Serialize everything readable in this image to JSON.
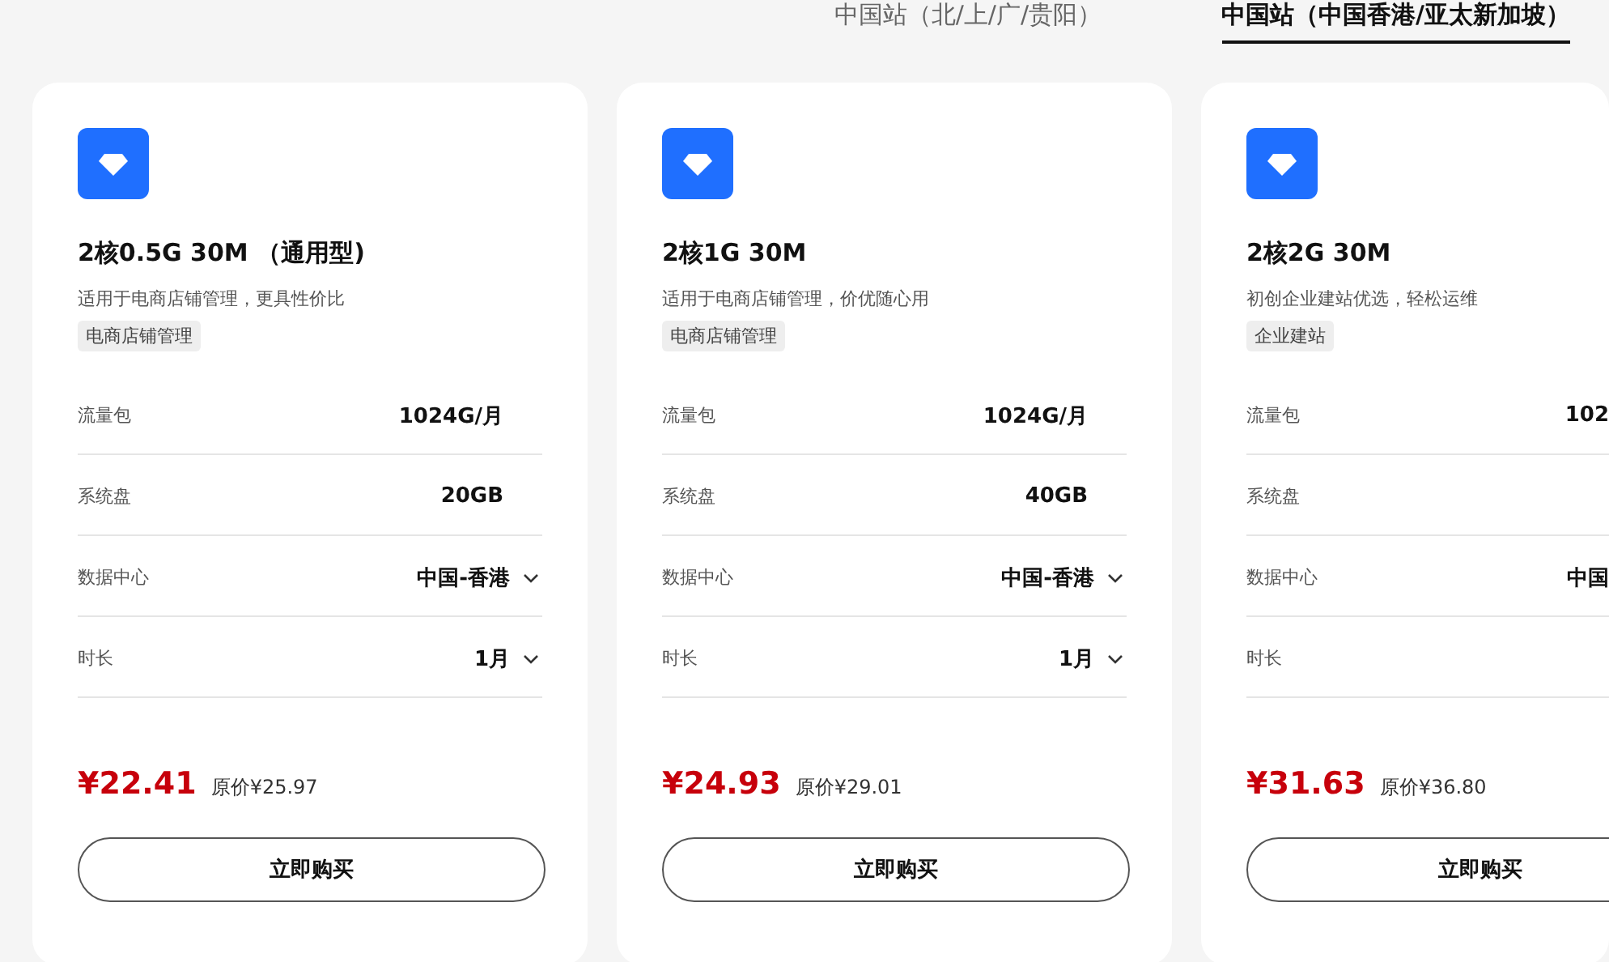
{
  "tabs": [
    {
      "label": "中国站（北/上/广/贵阳）",
      "selected": false
    },
    {
      "label": "中国站（中国香港/亚太新加坡）",
      "selected": true
    }
  ],
  "cards": [
    {
      "title": "2核0.5G 30M （通用型)",
      "description": "适用于电商店铺管理，更具性价比",
      "tag": "电商店铺管理",
      "specs": [
        {
          "label": "流量包",
          "value": "1024G/月",
          "dropdown": false
        },
        {
          "label": "系统盘",
          "value": "20GB",
          "dropdown": false
        },
        {
          "label": "数据中心",
          "value": "中国-香港",
          "dropdown": true
        },
        {
          "label": "时长",
          "value": "1月",
          "dropdown": true
        }
      ],
      "price": "¥22.41",
      "original_price": "原价¥25.97",
      "button": "立即购买"
    },
    {
      "title": "2核1G 30M",
      "description": "适用于电商店铺管理，价优随心用",
      "tag": "电商店铺管理",
      "specs": [
        {
          "label": "流量包",
          "value": "1024G/月",
          "dropdown": false
        },
        {
          "label": "系统盘",
          "value": "40GB",
          "dropdown": false
        },
        {
          "label": "数据中心",
          "value": "中国-香港",
          "dropdown": true
        },
        {
          "label": "时长",
          "value": "1月",
          "dropdown": true
        }
      ],
      "price": "¥24.93",
      "original_price": "原价¥29.01",
      "button": "立即购买"
    },
    {
      "title": "2核2G 30M",
      "description": "初创企业建站优选，轻松运维",
      "tag": "企业建站",
      "specs": [
        {
          "label": "流量包",
          "value": "102",
          "dropdown": false
        },
        {
          "label": "系统盘",
          "dropdown": false
        },
        {
          "label": "数据中心",
          "value": "中国",
          "dropdown": false
        },
        {
          "label": "时长",
          "dropdown": false
        }
      ],
      "price": "¥31.63",
      "original_price": "原价¥36.80",
      "button": "立即购买"
    }
  ]
}
